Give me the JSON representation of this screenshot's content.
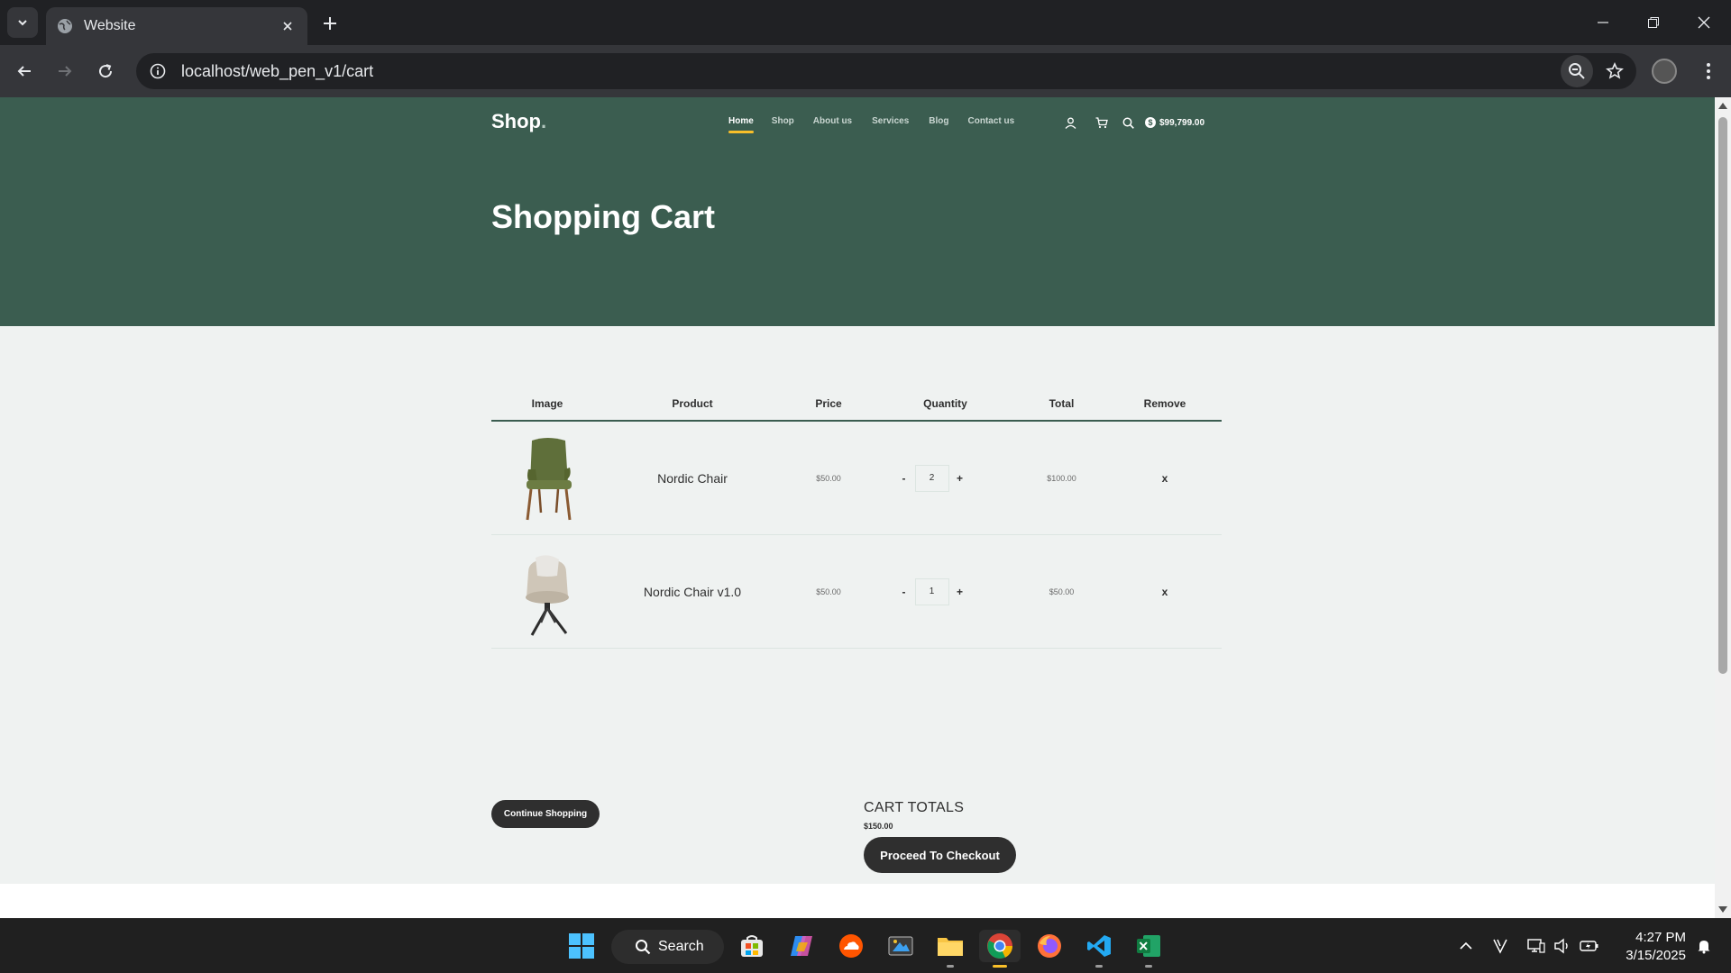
{
  "browser": {
    "tab_title": "Website",
    "url": "localhost/web_pen_v1/cart"
  },
  "site": {
    "logo": "Shop",
    "logo_dot": ".",
    "nav": [
      "Home",
      "Shop",
      "About us",
      "Services",
      "Blog",
      "Contact us"
    ],
    "active_nav": "Home",
    "balance": "$99,799.00",
    "page_title": "Shopping Cart"
  },
  "cart": {
    "headers": [
      "Image",
      "Product",
      "Price",
      "Quantity",
      "Total",
      "Remove"
    ],
    "items": [
      {
        "name": "Nordic Chair",
        "price": "$50.00",
        "qty": "2",
        "total": "$100.00",
        "remove": "x",
        "minus": "-",
        "plus": "+"
      },
      {
        "name": "Nordic Chair v1.0",
        "price": "$50.00",
        "qty": "1",
        "total": "$50.00",
        "remove": "x",
        "minus": "-",
        "plus": "+"
      }
    ],
    "continue_label": "Continue Shopping",
    "totals_heading": "CART TOTALS",
    "totals_amount": "$150.00",
    "checkout_label": "Proceed To Checkout"
  },
  "taskbar": {
    "search_label": "Search",
    "time": "4:27 PM",
    "date": "3/15/2025"
  },
  "colors": {
    "hero": "#3b5d50",
    "accent": "#f9bf29",
    "button": "#2f2f2f",
    "background": "#eff2f1"
  }
}
